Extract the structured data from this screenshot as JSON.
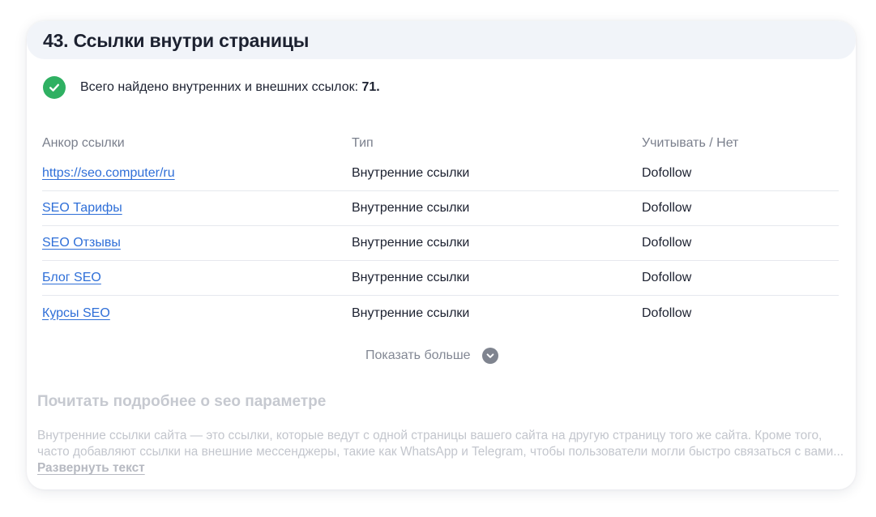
{
  "section": {
    "title": "43. Ссылки внутри страницы"
  },
  "summary": {
    "text": "Всего найдено внутренних и внешних ссылок: ",
    "count": "71."
  },
  "table": {
    "headers": {
      "anchor": "Анкор ссылки",
      "type": "Тип",
      "follow": "Учитывать / Нет"
    },
    "rows": [
      {
        "anchor": "https://seo.computer/ru",
        "type": "Внутренние ссылки",
        "follow": "Dofollow"
      },
      {
        "anchor": "SEO Тарифы",
        "type": "Внутренние ссылки",
        "follow": "Dofollow"
      },
      {
        "anchor": "SEO Отзывы",
        "type": "Внутренние ссылки",
        "follow": "Dofollow"
      },
      {
        "anchor": "Блог SEO",
        "type": "Внутренние ссылки",
        "follow": "Dofollow"
      },
      {
        "anchor": "Курсы SEO",
        "type": "Внутренние ссылки",
        "follow": "Dofollow"
      }
    ]
  },
  "show_more": {
    "label": "Показать больше",
    "icon": "chevron-down-icon"
  },
  "read_more": {
    "title": "Почитать подробнее о seo параметре",
    "text": "Внутренние ссылки сайта — это ссылки, которые ведут с одной страницы вашего сайта на другую страницу того же сайта. Кроме того, часто добавляют ссылки на внешние мессенджеры, такие как WhatsApp и Telegram, чтобы пользователи могли быстро связаться с вами... ",
    "expand_label": "Развернуть текст"
  },
  "colors": {
    "success": "#2fb062",
    "link": "#2f6fd8",
    "header_bg": "#f1f4f9"
  }
}
